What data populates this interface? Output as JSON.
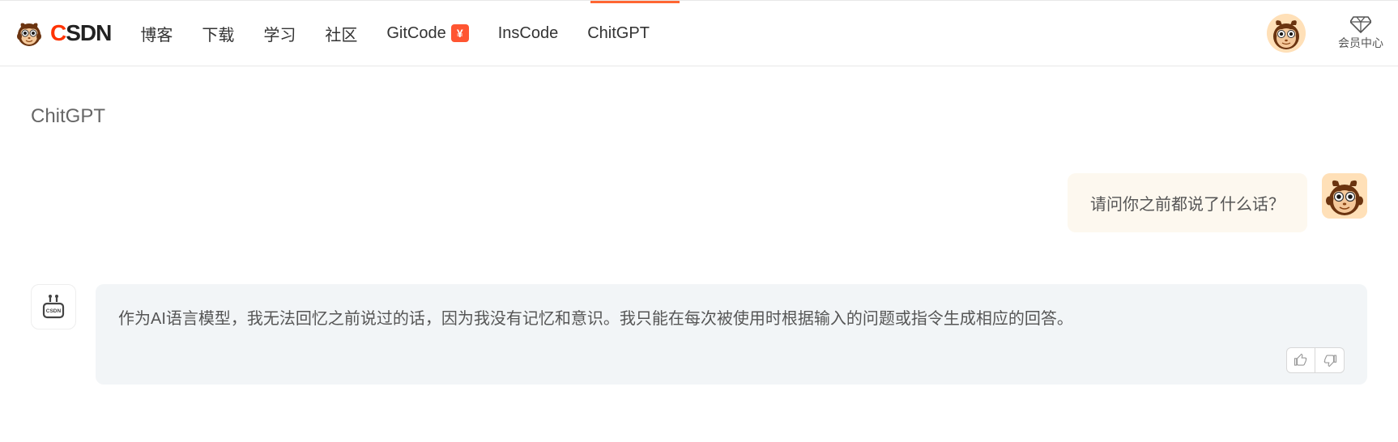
{
  "header": {
    "logo_text_c": "C",
    "logo_text_sdn": "SDN",
    "nav": [
      {
        "label": "博客"
      },
      {
        "label": "下载"
      },
      {
        "label": "学习"
      },
      {
        "label": "社区"
      },
      {
        "label": "GitCode",
        "has_badge": true
      },
      {
        "label": "InsCode"
      },
      {
        "label": "ChitGPT"
      }
    ],
    "badge_symbol": "¥",
    "vip_label": "会员中心"
  },
  "page": {
    "title": "ChitGPT"
  },
  "chat": {
    "user_message": "请问你之前都说了什么话？",
    "bot_message": "作为AI语言模型，我无法回忆之前说过的话，因为我没有记忆和意识。我只能在每次被使用时根据输入的问题或指令生成相应的回答。"
  }
}
